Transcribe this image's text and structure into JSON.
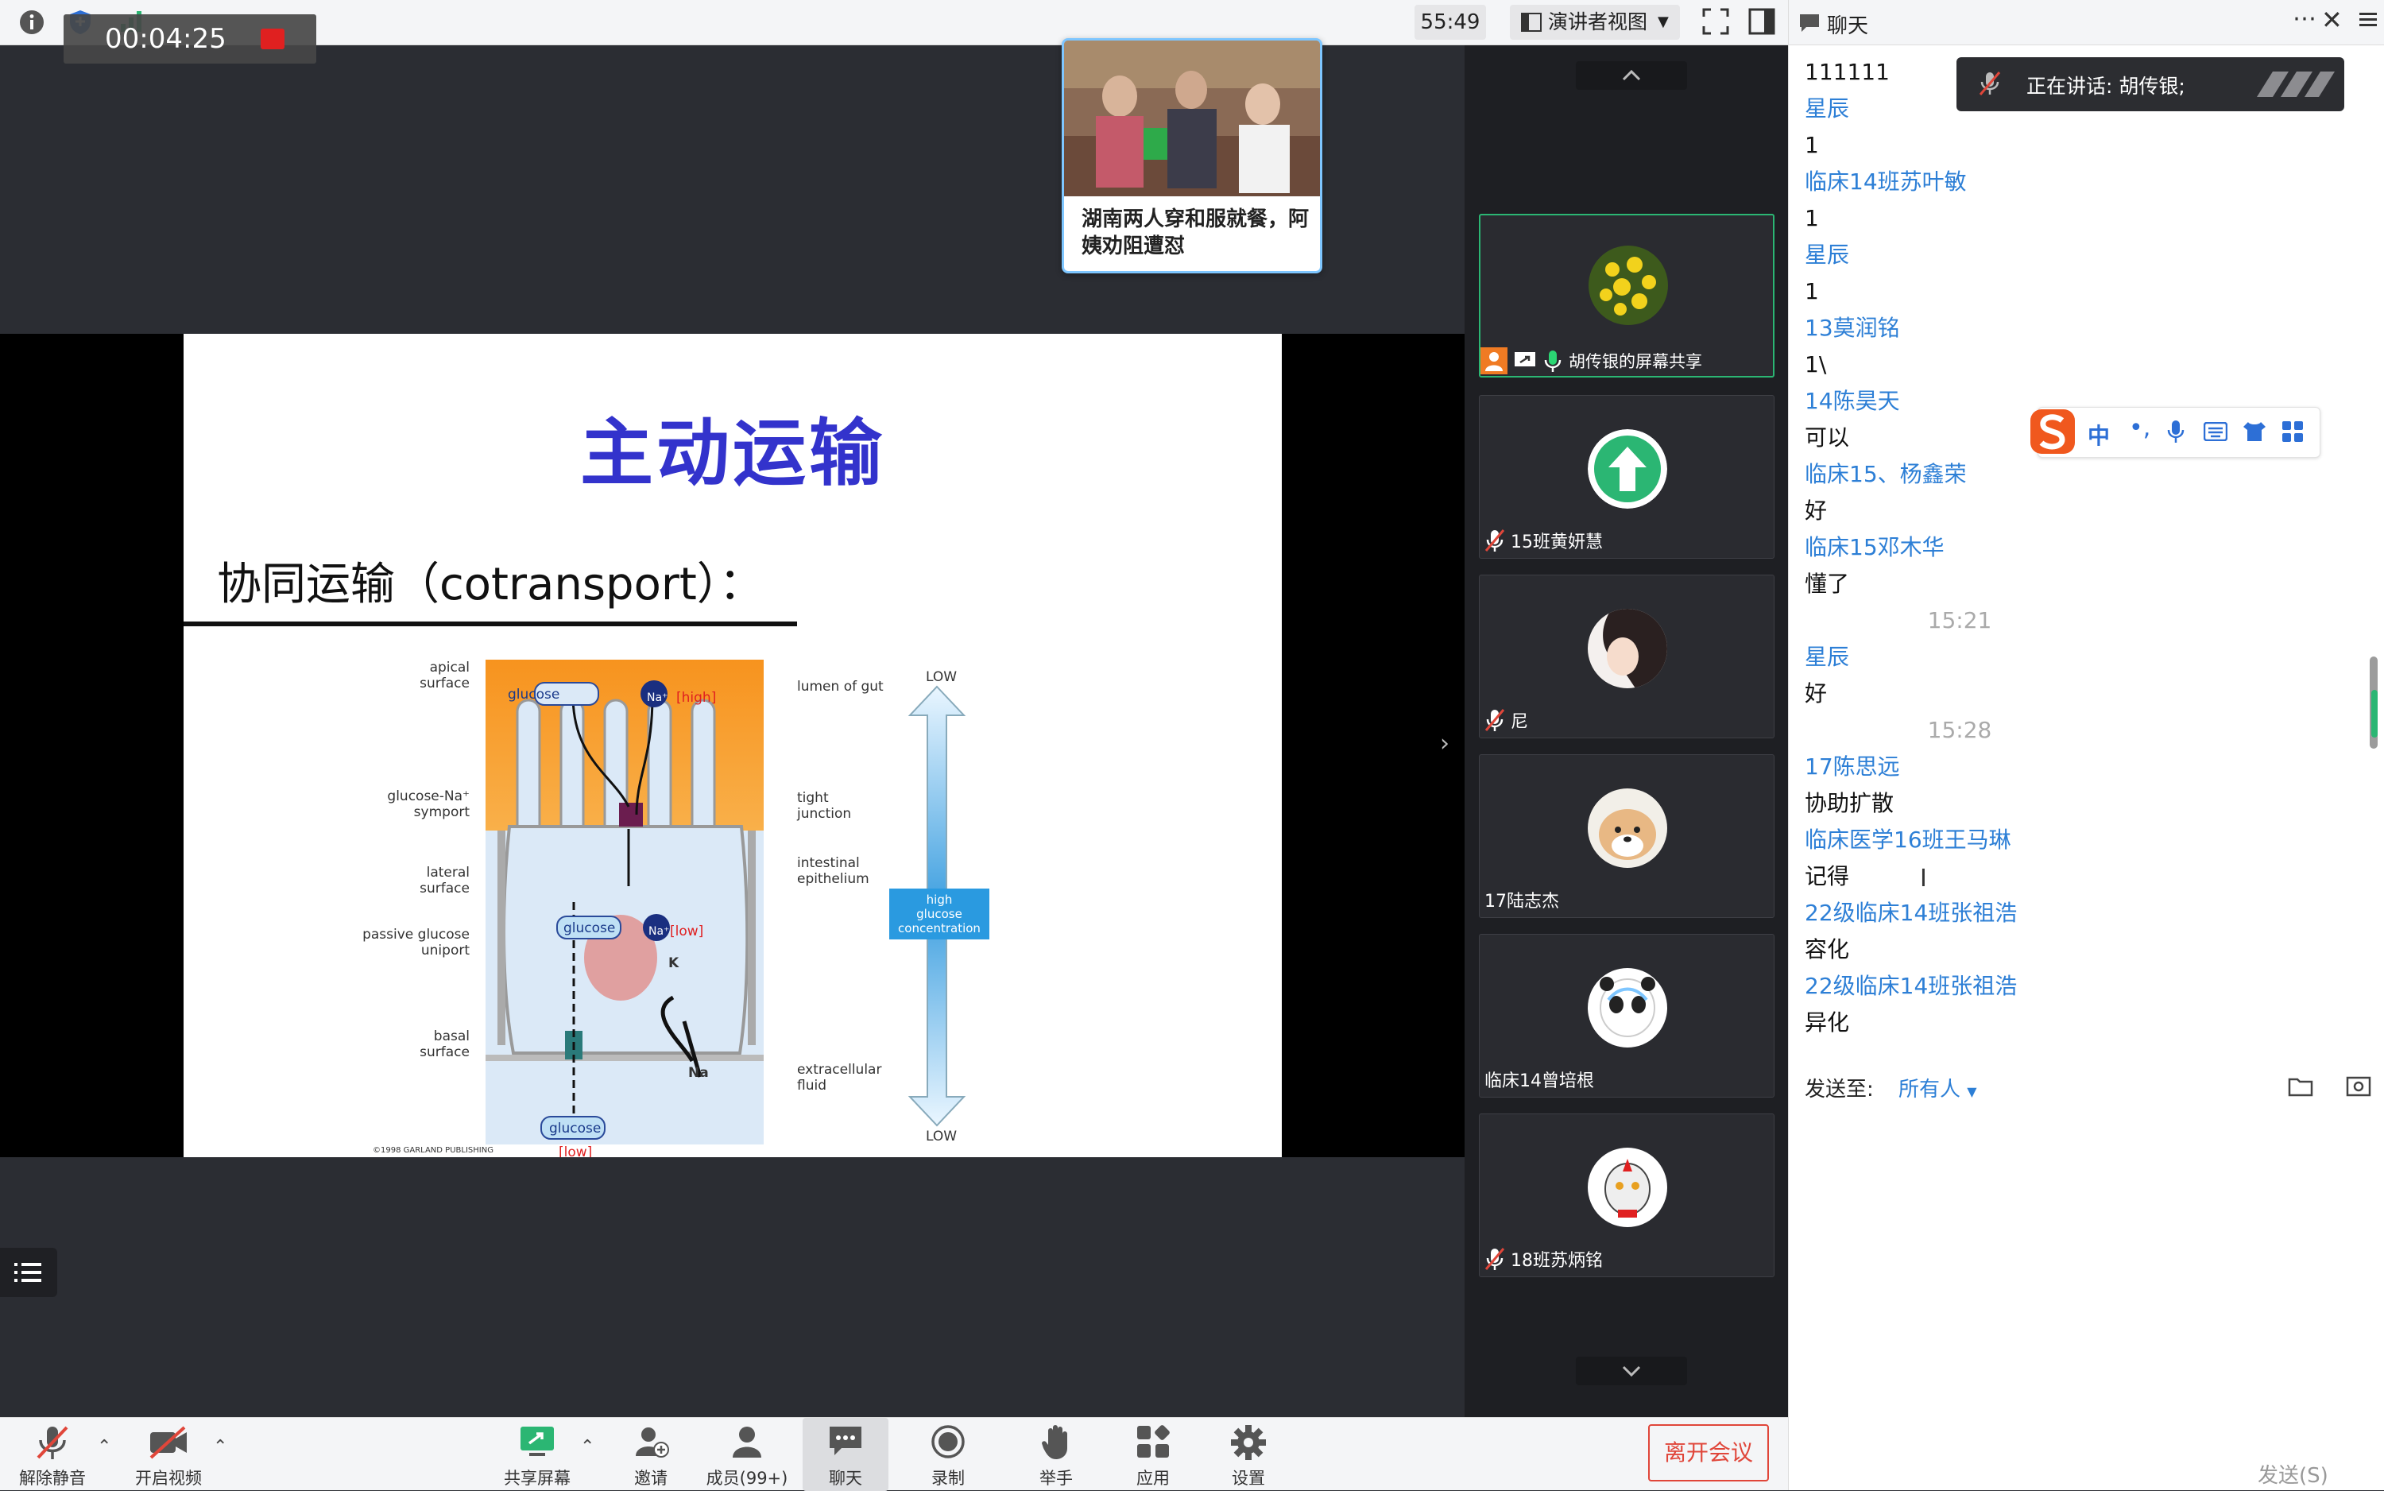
{
  "recording": {
    "elapsed": "00:04:25"
  },
  "topbar": {
    "meeting_timer": "55:49",
    "view_mode": "演讲者视图"
  },
  "news_popup": {
    "headline": "湖南两人穿和服就餐，阿姨劝阻遭怼"
  },
  "slide": {
    "title": "主动运输",
    "subtitle": "协同运输（cotransport）：",
    "diagram": {
      "labels_left": [
        "apical\nsurface",
        "glucose-Na⁺\nsymport",
        "lateral\nsurface",
        "passive glucose\nuniport",
        "basal\nsurface"
      ],
      "labels_right": [
        "lumen of gut",
        "tight\njunction",
        "intestinal\nepithelium",
        "extracellular\nfluid"
      ],
      "cell_labels": {
        "glucose": "glucose",
        "na": "Na⁺",
        "low": "[low]",
        "high": "[high]",
        "k": "K",
        "na_plain": "Na"
      },
      "gradient_top": "LOW",
      "gradient_bottom": "LOW",
      "gradient_mid": "high\nglucose\nconcentration",
      "copyright": "©1998 GARLAND PUBLISHING"
    }
  },
  "participants": [
    {
      "name": "胡传银的屏幕共享",
      "active": true
    },
    {
      "name": "15班黄妍慧"
    },
    {
      "name": "尼"
    },
    {
      "name": "17陆志杰"
    },
    {
      "name": "临床14曾培根"
    },
    {
      "name": "18班苏炳铭"
    }
  ],
  "chat": {
    "title": "聊天",
    "speaking_label": "正在讲话: 胡传银;",
    "messages": [
      {
        "kind": "body",
        "text": "111111"
      },
      {
        "kind": "sender",
        "text": "星辰"
      },
      {
        "kind": "body",
        "text": "1"
      },
      {
        "kind": "sender",
        "text": "临床14班苏叶敏"
      },
      {
        "kind": "body",
        "text": "1"
      },
      {
        "kind": "sender",
        "text": "星辰"
      },
      {
        "kind": "body",
        "text": "1"
      },
      {
        "kind": "sender",
        "text": "13莫润铭"
      },
      {
        "kind": "body",
        "text": "1\\"
      },
      {
        "kind": "sender",
        "text": "14陈昊天"
      },
      {
        "kind": "body",
        "text": "可以"
      },
      {
        "kind": "sender",
        "text": "临床15、杨鑫荣"
      },
      {
        "kind": "body",
        "text": "好"
      },
      {
        "kind": "sender",
        "text": "临床15邓木华"
      },
      {
        "kind": "body",
        "text": "懂了"
      },
      {
        "kind": "time",
        "text": "15:21"
      },
      {
        "kind": "sender",
        "text": "星辰"
      },
      {
        "kind": "body",
        "text": "好"
      },
      {
        "kind": "time",
        "text": "15:28"
      },
      {
        "kind": "sender",
        "text": "17陈思远"
      },
      {
        "kind": "body",
        "text": "协助扩散"
      },
      {
        "kind": "sender",
        "text": "临床医学16班王马琳"
      },
      {
        "kind": "body",
        "text": "记得"
      },
      {
        "kind": "sender",
        "text": "22级临床14班张祖浩"
      },
      {
        "kind": "body",
        "text": "容化"
      },
      {
        "kind": "sender",
        "text": "22级临床14班张祖浩"
      },
      {
        "kind": "body",
        "text": "异化"
      }
    ],
    "send_to_label": "发送至:",
    "send_to_value": "所有人",
    "send_button": "发送(S)"
  },
  "ime_toolbar": {
    "mode": "中"
  },
  "toolbar": {
    "unmute": "解除静音",
    "start_video": "开启视频",
    "share_screen": "共享屏幕",
    "invite": "邀请",
    "members": "成员(99+)",
    "chat": "聊天",
    "record": "录制",
    "raise_hand": "举手",
    "apps": "应用",
    "settings": "设置",
    "leave": "离开会议"
  },
  "colors": {
    "accent_blue": "#2d7fd6",
    "leave_red": "#e0463a",
    "active_green": "#2bb673",
    "slide_title": "#3333cc"
  }
}
